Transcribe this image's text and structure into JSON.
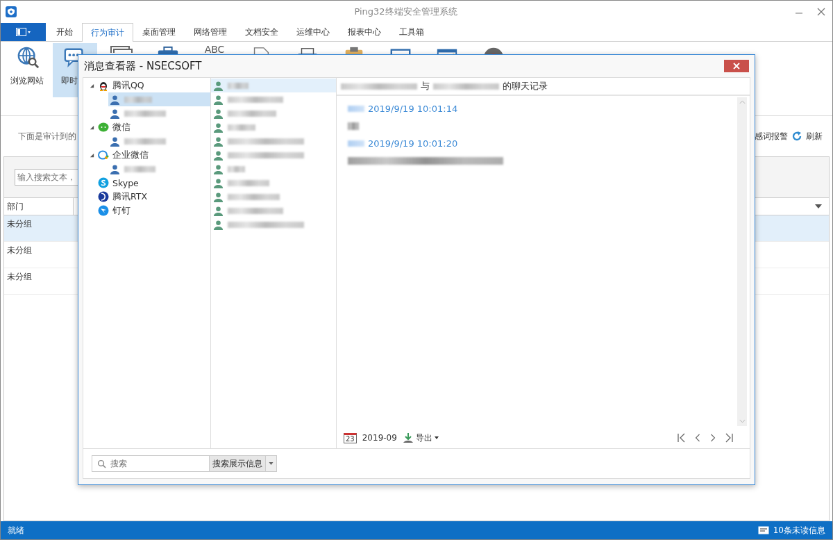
{
  "window": {
    "title": "Ping32终端安全管理系统"
  },
  "menu_tabs": [
    {
      "label": "开始",
      "selected": false
    },
    {
      "label": "行为审计",
      "selected": true
    },
    {
      "label": "桌面管理",
      "selected": false
    },
    {
      "label": "网络管理",
      "selected": false
    },
    {
      "label": "文档安全",
      "selected": false
    },
    {
      "label": "运维中心",
      "selected": false
    },
    {
      "label": "报表中心",
      "selected": false
    },
    {
      "label": "工具箱",
      "selected": false
    }
  ],
  "ribbon": [
    {
      "kind": "globe",
      "label": "浏览网站",
      "selected": false
    },
    {
      "kind": "chat",
      "label": "即时",
      "selected": true
    },
    {
      "kind": "windows"
    },
    {
      "kind": "briefcase"
    },
    {
      "kind": "abc",
      "icon_text": "ABC"
    },
    {
      "kind": "document"
    },
    {
      "kind": "printer"
    },
    {
      "kind": "clipboard"
    },
    {
      "kind": "monitor"
    },
    {
      "kind": "window"
    },
    {
      "kind": "record"
    }
  ],
  "hint": "下面是审计到的",
  "actions": [
    {
      "label": "感词报警"
    },
    {
      "label": "刷新"
    }
  ],
  "table": {
    "search": {
      "placeholder": "输入搜索文本，"
    },
    "columns": [
      "部门"
    ],
    "rows": [
      {
        "cells": [
          "未分组"
        ],
        "selected": true
      },
      {
        "cells": [
          "未分组"
        ],
        "selected": false
      },
      {
        "cells": [
          "未分组"
        ],
        "selected": false
      }
    ]
  },
  "status_bar": {
    "text": "就绪",
    "messages": "10条未读信息"
  },
  "dialog": {
    "title": "消息查看器 - NSECSOFT",
    "tree": [
      {
        "kind": "qq",
        "label": "腾讯QQ",
        "expanded": true,
        "children": [
          {
            "selected": true
          },
          {
            "selected": false
          }
        ]
      },
      {
        "kind": "wechat",
        "label": "微信",
        "expanded": true,
        "children": [
          {
            "selected": false
          }
        ]
      },
      {
        "kind": "wework",
        "label": "企业微信",
        "expanded": true,
        "children": [
          {
            "selected": false
          }
        ]
      },
      {
        "kind": "skype",
        "label": "Skype"
      },
      {
        "kind": "rtx",
        "label": "腾讯RTX"
      },
      {
        "kind": "dingtalk",
        "label": "钉钉"
      }
    ],
    "contacts": [
      {
        "selected": true
      },
      {
        "selected": false
      },
      {
        "selected": false
      },
      {
        "selected": false
      },
      {
        "selected": false
      },
      {
        "selected": false
      },
      {
        "selected": false
      },
      {
        "selected": false
      },
      {
        "selected": false
      },
      {
        "selected": false
      },
      {
        "selected": false
      }
    ],
    "chat_title": {
      "joiner": "与",
      "suffix": "的聊天记录"
    },
    "messages": [
      {
        "time": "2019/9/19 10:01:14"
      },
      {
        "time": "2019/9/19 10:01:20"
      }
    ],
    "calendar_day": "23",
    "month": "2019-09",
    "export": "导出",
    "search": {
      "placeholder": "搜索"
    },
    "search_button": "搜索展示信息"
  }
}
